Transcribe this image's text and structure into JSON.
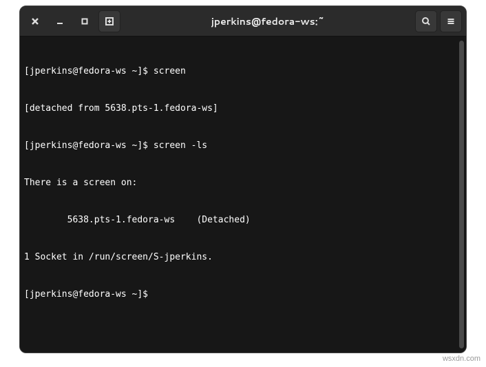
{
  "window": {
    "title": "jperkins@fedora-ws:~"
  },
  "terminal": {
    "lines": [
      "[jperkins@fedora-ws ~]$ screen",
      "[detached from 5638.pts-1.fedora-ws]",
      "[jperkins@fedora-ws ~]$ screen -ls",
      "There is a screen on:",
      "        5638.pts-1.fedora-ws    (Detached)",
      "1 Socket in /run/screen/S-jperkins.",
      "[jperkins@fedora-ws ~]$ "
    ]
  },
  "watermark": "wsxdn.com"
}
